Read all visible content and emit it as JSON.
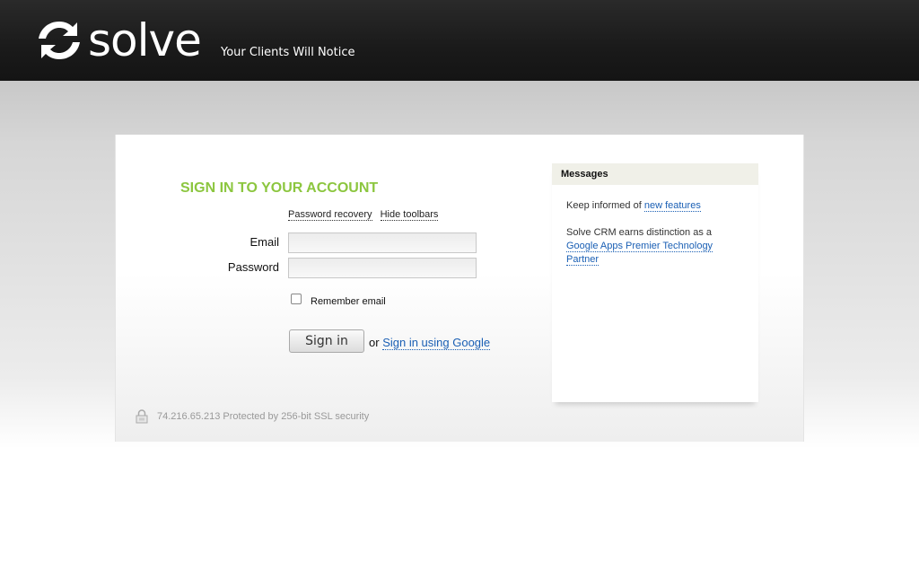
{
  "header": {
    "logo_text": "solve",
    "tagline": "Your Clients Will Notice"
  },
  "signin": {
    "title": "SIGN IN TO YOUR ACCOUNT",
    "links": {
      "password_recovery": "Password recovery",
      "hide_toolbars": "Hide toolbars"
    },
    "email_label": "Email",
    "email_value": "",
    "password_label": "Password",
    "password_value": "",
    "remember_label": "Remember email",
    "remember_checked": false,
    "signin_button": "Sign in",
    "or_text": "or",
    "google_link": "Sign in using Google"
  },
  "security": {
    "text": "74.216.65.213 Protected by 256-bit SSL security",
    "icon": "lock-icon"
  },
  "messages": {
    "title": "Messages",
    "item1_prefix": "Keep informed of ",
    "item1_link": "new features",
    "item2_prefix": "Solve CRM earns distinction as a",
    "item2_link": "Google Apps Premier Technology Partner"
  },
  "colors": {
    "accent_green": "#8cc63f",
    "link_blue": "#1a5fb4",
    "header_bg": "#1a1a1a"
  }
}
